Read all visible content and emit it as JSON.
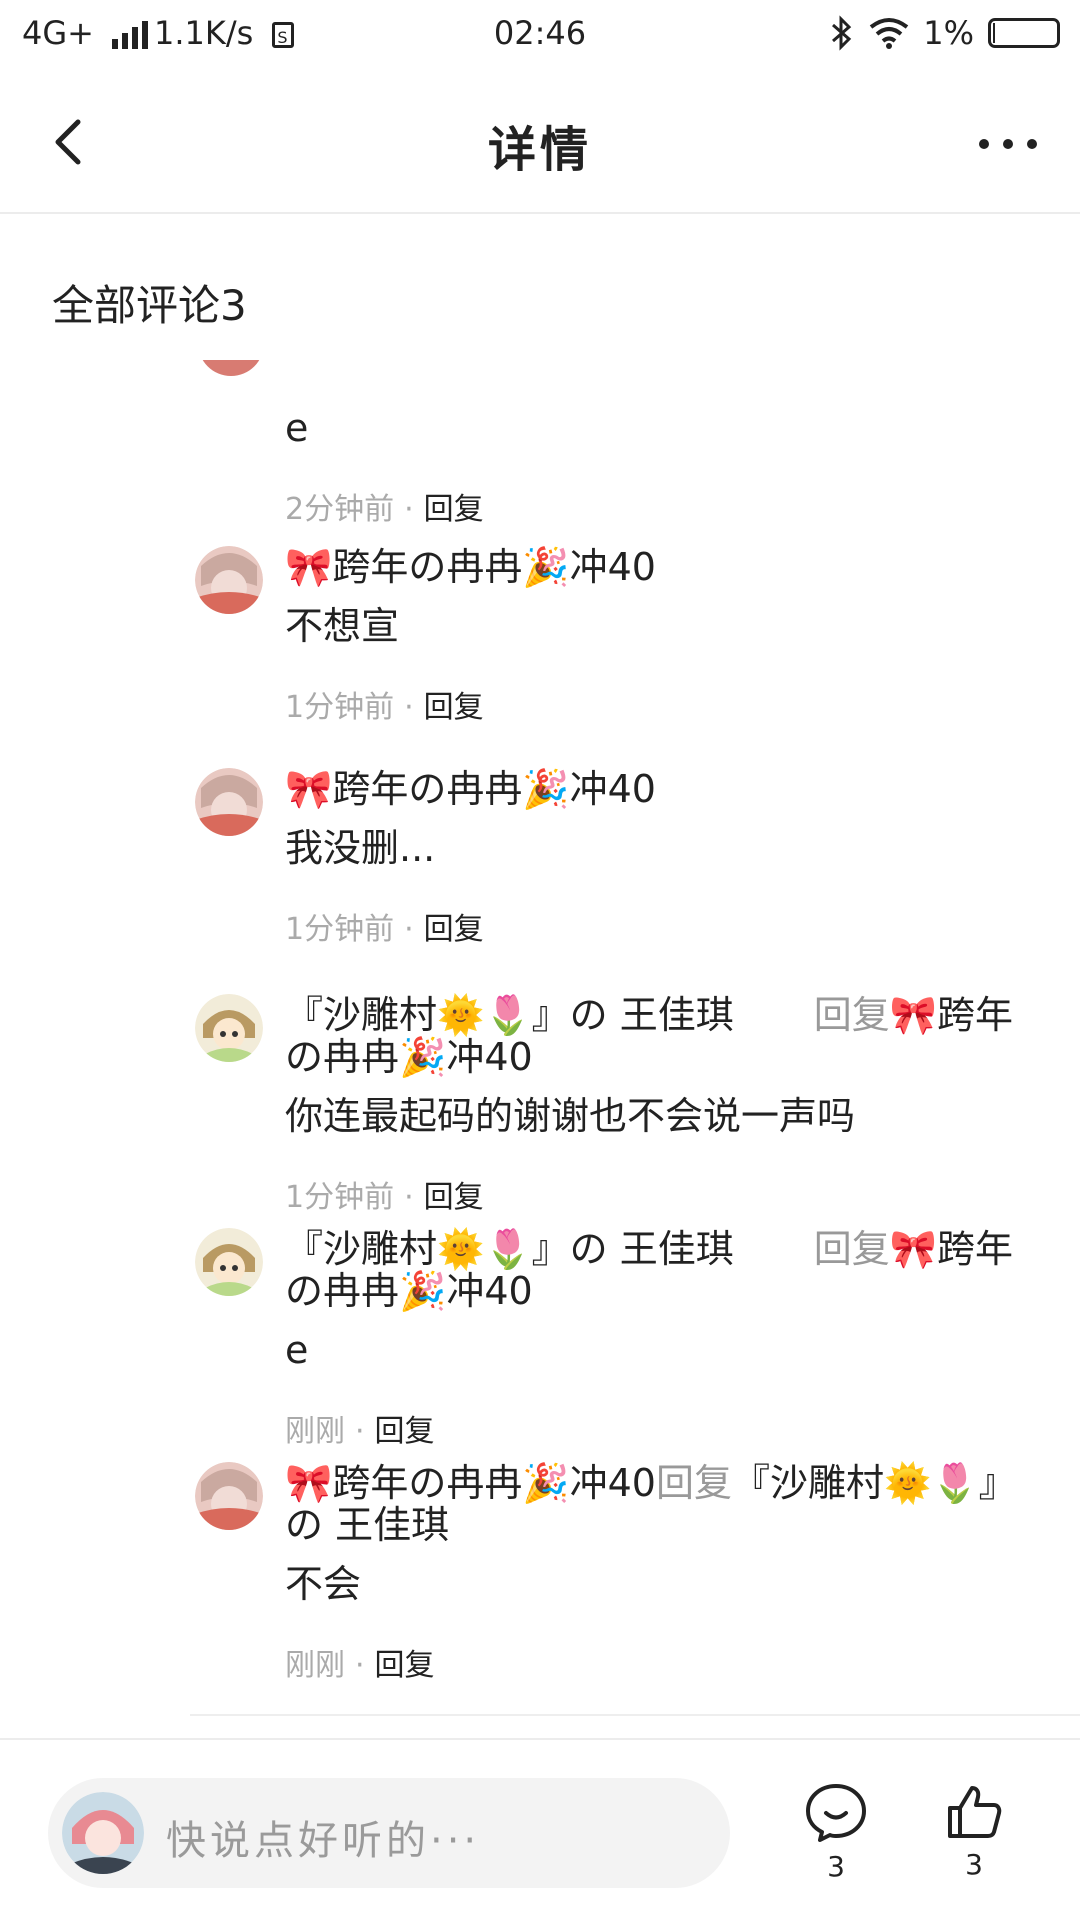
{
  "status_bar": {
    "network": "4G+",
    "speed": "1.1K/s",
    "time": "02:46",
    "battery": "1%"
  },
  "header": {
    "title": "详情"
  },
  "comments_section": {
    "title": "全部评论3"
  },
  "comments": [
    {
      "partial": true,
      "content": "e",
      "time": "2分钟前",
      "reply_label": "回复"
    },
    {
      "author": "🎀跨年の冉冉🎉冲40",
      "content": "不想宣",
      "time": "1分钟前",
      "reply_label": "回复"
    },
    {
      "author": "🎀跨年の冉冉🎉冲40",
      "content": "我没删...",
      "time": "1分钟前",
      "reply_label": "回复"
    },
    {
      "author": "『沙雕村🌞🌷』の 王佳琪",
      "reply_word": "回复",
      "reply_target": "🎀跨年の冉冉🎉冲40",
      "content": "你连最起码的谢谢也不会说一声吗",
      "time": "1分钟前",
      "reply_label": "回复"
    },
    {
      "author": "『沙雕村🌞🌷』の 王佳琪",
      "reply_word": "回复",
      "reply_target": "🎀跨年の冉冉🎉冲40",
      "content": "e",
      "time": "刚刚",
      "reply_label": "回复"
    },
    {
      "author": "🎀跨年の冉冉🎉冲40",
      "reply_word": "回复",
      "reply_target": "『沙雕村🌞🌷』の 王佳琪",
      "content": "不会",
      "time": "刚刚",
      "reply_label": "回复"
    }
  ],
  "meta_separator": "·",
  "bottom_bar": {
    "input_placeholder": "快说点好听的···",
    "comment_count": "3",
    "like_count": "3"
  },
  "icons": {
    "back": "chevron-left-icon",
    "more": "more-dots-icon",
    "comment": "comment-bubble-icon",
    "like": "thumbs-up-icon"
  },
  "colors": {
    "meta_gray": "#aaaaaa",
    "reply_gray": "#999999",
    "divider": "#eeeeee"
  }
}
